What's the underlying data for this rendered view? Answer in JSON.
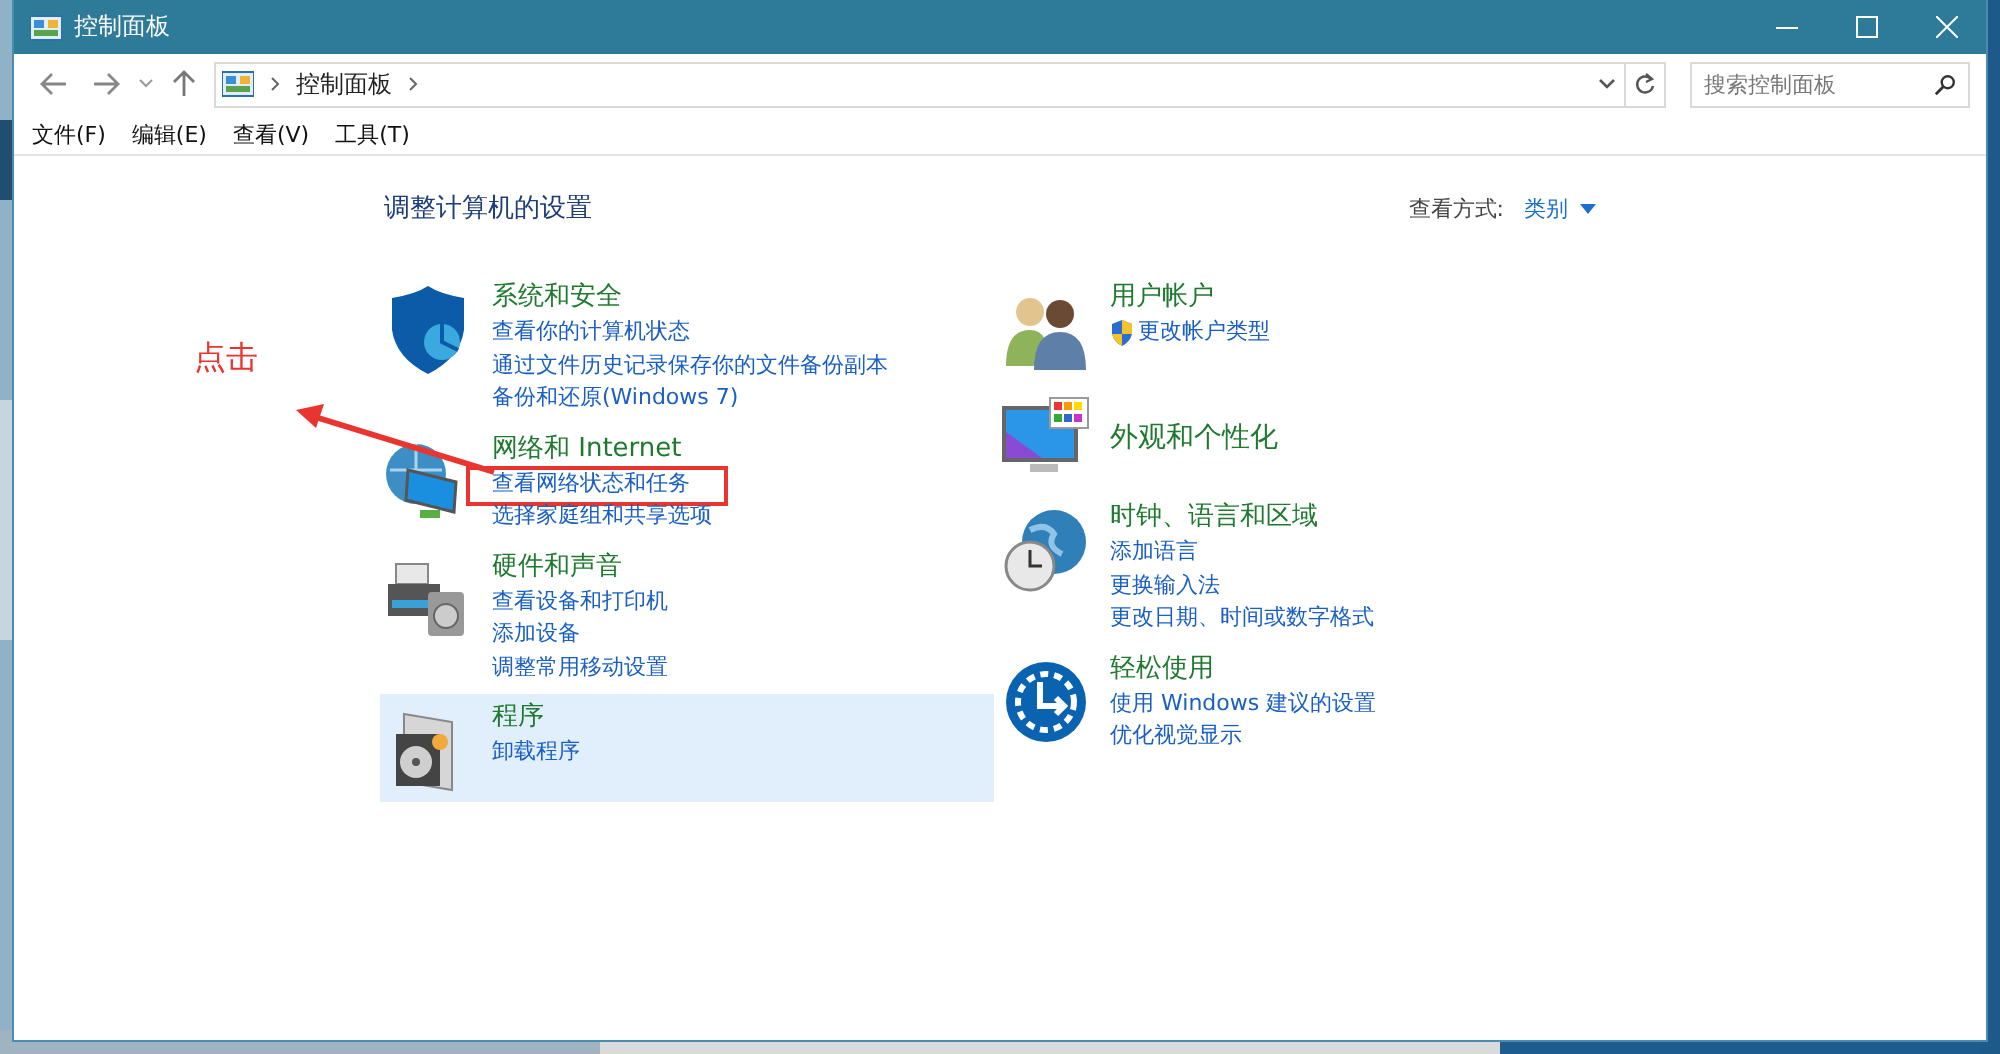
{
  "window": {
    "title": "控制面板"
  },
  "address_bar": {
    "crumbs": [
      "控制面板"
    ]
  },
  "search": {
    "placeholder": "搜索控制面板"
  },
  "menu": [
    "文件(F)",
    "编辑(E)",
    "查看(V)",
    "工具(T)"
  ],
  "heading": "调整计算机的设置",
  "view_by": {
    "label": "查看方式:",
    "value": "类别"
  },
  "columns": [
    {
      "categories": [
        {
          "title": "系统和安全",
          "highlighted": false,
          "links": [
            {
              "text": "查看你的计算机状态",
              "admin": false,
              "marked": false
            },
            {
              "text": "通过文件历史记录保存你的文件备份副本",
              "admin": false,
              "marked": false
            },
            {
              "text": "备份和还原(Windows 7)",
              "admin": false,
              "marked": false
            }
          ]
        },
        {
          "title": "网络和 Internet",
          "highlighted": false,
          "links": [
            {
              "text": "查看网络状态和任务",
              "admin": false,
              "marked": true
            },
            {
              "text": "选择家庭组和共享选项",
              "admin": false,
              "marked": false
            }
          ]
        },
        {
          "title": "硬件和声音",
          "highlighted": false,
          "links": [
            {
              "text": "查看设备和打印机",
              "admin": false,
              "marked": false
            },
            {
              "text": "添加设备",
              "admin": false,
              "marked": false
            },
            {
              "text": "调整常用移动设置",
              "admin": false,
              "marked": false
            }
          ]
        },
        {
          "title": "程序",
          "highlighted": true,
          "links": [
            {
              "text": "卸载程序",
              "admin": false,
              "marked": false
            }
          ]
        }
      ]
    },
    {
      "categories": [
        {
          "title": "用户帐户",
          "highlighted": false,
          "links": [
            {
              "text": "更改帐户类型",
              "admin": true,
              "marked": false
            }
          ]
        },
        {
          "title": "外观和个性化",
          "highlighted": false
        },
        {
          "title": "时钟、语言和区域",
          "highlighted": false,
          "links": [
            {
              "text": "添加语言",
              "admin": false,
              "marked": false
            },
            {
              "text": "更换输入法",
              "admin": false,
              "marked": false
            },
            {
              "text": "更改日期、时间或数字格式",
              "admin": false,
              "marked": false
            }
          ]
        },
        {
          "title": "轻松使用",
          "highlighted": false,
          "links": [
            {
              "text": "使用 Windows 建议的设置",
              "admin": false,
              "marked": false
            },
            {
              "text": "优化视觉显示",
              "admin": false,
              "marked": false
            }
          ]
        }
      ]
    }
  ],
  "annotation": {
    "label": "点击"
  }
}
